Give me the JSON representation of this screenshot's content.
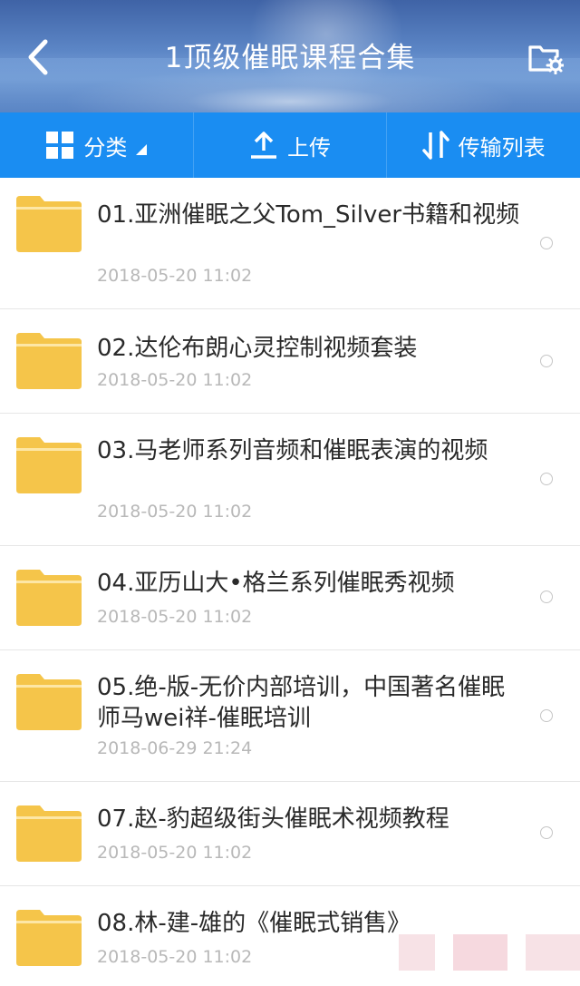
{
  "header": {
    "title": "1顶级催眠课程合集",
    "back_icon": "chevron-left-icon",
    "right_icon": "folder-settings-icon"
  },
  "toolbar": {
    "category_label": "分类",
    "upload_label": "上传",
    "transfer_label": "传输列表"
  },
  "files": [
    {
      "name": "01.亚洲催眠之父Tom_Silver书籍和视频",
      "date": "2018-05-20",
      "time": "11:02"
    },
    {
      "name": "02.达伦布朗心灵控制视频套装",
      "date": "2018-05-20",
      "time": "11:02"
    },
    {
      "name": "03.马老师系列音频和催眠表演的视频",
      "date": "2018-05-20",
      "time": "11:02"
    },
    {
      "name": "04.亚历山大•格兰系列催眠秀视频",
      "date": "2018-05-20",
      "time": "11:02"
    },
    {
      "name": "05.绝-版-无价内部培训，中国著名催眠师马wei祥-催眠培训",
      "date": "2018-06-29",
      "time": "21:24"
    },
    {
      "name": "07.赵-豹超级街头催眠术视频教程",
      "date": "2018-05-20",
      "time": "11:02"
    },
    {
      "name": "08.林-建-雄的《催眠式销售》",
      "date": "2018-05-20",
      "time": "11:02"
    }
  ],
  "colors": {
    "toolbar_bg": "#1a8df2",
    "folder_yellow": "#f5c54a",
    "date_gray": "#b8b8b8"
  }
}
